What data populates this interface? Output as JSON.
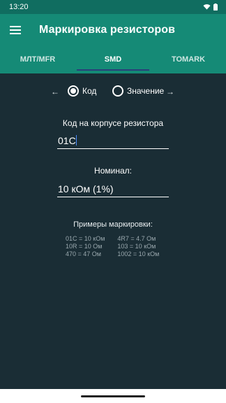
{
  "status": {
    "time": "13:20"
  },
  "appbar": {
    "title": "Маркировка резисторов"
  },
  "tabs": [
    {
      "label": "МЛТ/MFR",
      "active": false
    },
    {
      "label": "SMD",
      "active": true
    },
    {
      "label": "TOMARK",
      "active": false
    }
  ],
  "mode": {
    "left_arrow": "←",
    "right_arrow": "→",
    "option_code": "Код",
    "option_value": "Значение",
    "selected": "Код"
  },
  "code_field": {
    "label": "Код на корпусе резистора",
    "value": "01C"
  },
  "nominal_field": {
    "label": "Номинал:",
    "value": "10 кОм (1%)"
  },
  "examples": {
    "title": "Примеры маркировки:",
    "col1": [
      "01C = 10 кОм",
      "10R = 10 Ом",
      "470 = 47 Ом"
    ],
    "col2": [
      "4R7 = 4.7 Ом",
      "103 = 10 кОм",
      "1002 = 10 кОм"
    ]
  },
  "colors": {
    "statusbar": "#106d60",
    "appbar": "#158a76",
    "background": "#1a2d35",
    "tab_indicator": "#2a3f7a"
  }
}
